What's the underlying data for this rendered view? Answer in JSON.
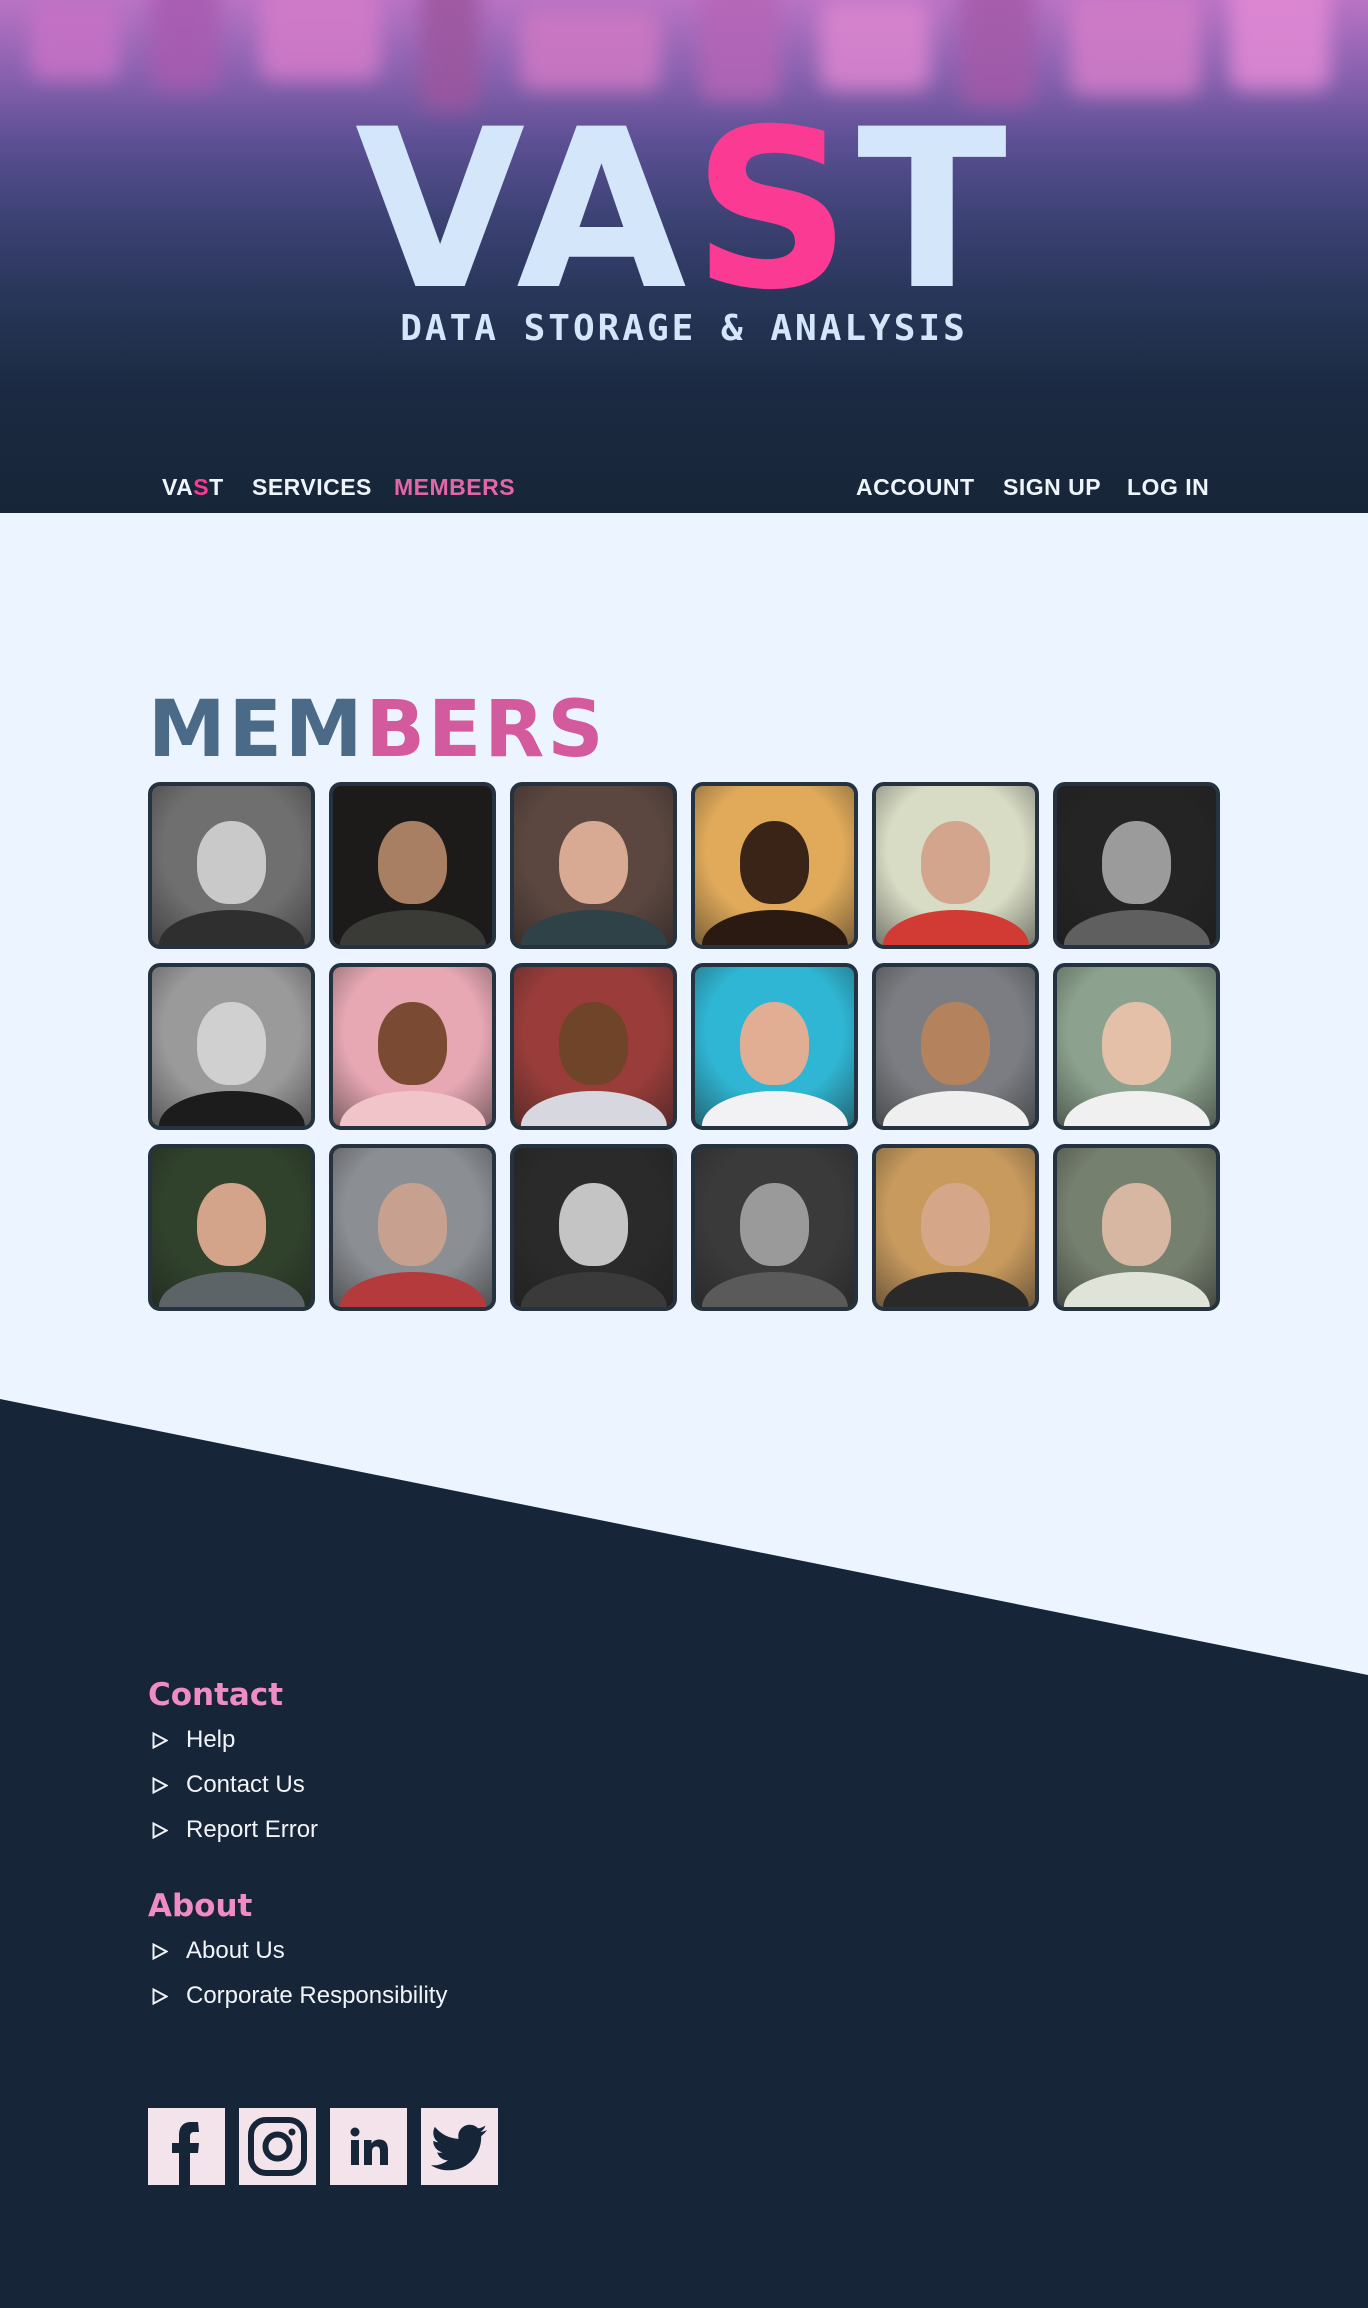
{
  "hero": {
    "title_pre": "VA",
    "title_accent": "S",
    "title_post": "T",
    "subtitle": "DATA STORAGE & ANALYSIS"
  },
  "nav": {
    "brand_pre": "VA",
    "brand_accent": "S",
    "brand_post": "T",
    "services": "SERVICES",
    "members": "MEMBERS",
    "account": "ACCOUNT",
    "signup": "SIGN UP",
    "login": "LOG IN"
  },
  "members": {
    "title_pre": "MEM",
    "title_accent": "BERS",
    "photos": [
      {
        "name": "member-1-photo"
      },
      {
        "name": "member-2-photo"
      },
      {
        "name": "member-3-photo"
      },
      {
        "name": "member-4-photo"
      },
      {
        "name": "member-5-photo"
      },
      {
        "name": "member-6-photo"
      },
      {
        "name": "member-7-photo"
      },
      {
        "name": "member-8-photo"
      },
      {
        "name": "member-9-photo"
      },
      {
        "name": "member-10-photo"
      },
      {
        "name": "member-11-photo"
      },
      {
        "name": "member-12-photo"
      },
      {
        "name": "member-13-photo"
      },
      {
        "name": "member-14-photo"
      },
      {
        "name": "member-15-photo"
      },
      {
        "name": "member-16-photo"
      },
      {
        "name": "member-17-photo"
      },
      {
        "name": "member-18-photo"
      }
    ]
  },
  "footer": {
    "contact": {
      "title": "Contact",
      "links": [
        "Help",
        "Contact Us",
        "Report Error"
      ]
    },
    "about": {
      "title": "About",
      "links": [
        "About Us",
        "Corporate Responsibility"
      ]
    },
    "social": [
      "facebook-icon",
      "instagram-icon",
      "linkedin-icon",
      "twitter-icon"
    ]
  },
  "colors": {
    "accent_pink": "#fb3b93",
    "heading_pink": "#f08cc5",
    "light_blue": "#d3e6fa",
    "dark_navy": "#172538",
    "page_bg": "#ecf5ff",
    "members_blue": "#4a6a88"
  }
}
